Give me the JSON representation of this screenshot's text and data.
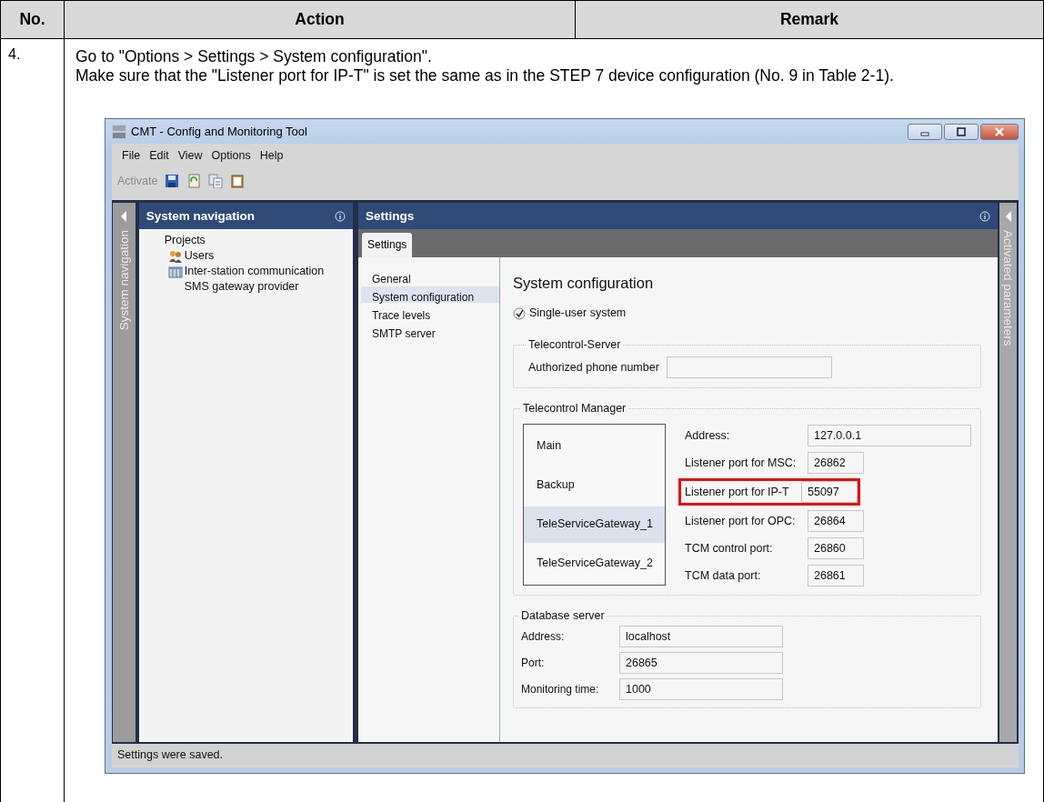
{
  "table": {
    "columns": [
      "No.",
      "Action",
      "Remark"
    ]
  },
  "step": {
    "number": "4.",
    "instructions": [
      "Go to \"Options > Settings > System configuration\".",
      "Make sure that the \"Listener port for IP-T\" is set the same as in the STEP 7 device configuration (No. 9 in Table 2-1)."
    ]
  },
  "window": {
    "title": "CMT - Config and Monitoring Tool",
    "menu": [
      "File",
      "Edit",
      "View",
      "Options",
      "Help"
    ],
    "toolbar": {
      "label": "Activate",
      "disabled": true
    },
    "left_strip": {
      "label": "System navigation"
    },
    "navigation": {
      "title": "System navigation",
      "items": [
        {
          "label": "Projects",
          "children": [
            {
              "label": "Users",
              "kind": "users"
            },
            {
              "label": "Inter-station communication",
              "kind": "table"
            },
            {
              "label": "SMS gateway provider",
              "kind": "plain"
            }
          ]
        }
      ]
    },
    "settings": {
      "title": "Settings",
      "tabs": [
        {
          "label": "Settings",
          "selected": true
        }
      ],
      "sections": [
        {
          "label": "General",
          "selected": false
        },
        {
          "label": "System configuration",
          "selected": true
        },
        {
          "label": "Trace levels",
          "selected": false
        },
        {
          "label": "SMTP server",
          "selected": false
        }
      ],
      "heading": "System configuration",
      "single_user": {
        "label": "Single-user system",
        "checked": true
      },
      "telecontrol_server": {
        "title": "Telecontrol-Server",
        "fields": [
          {
            "label": "Authorized phone number",
            "highlighted": false
          }
        ]
      },
      "telecontrol_manager": {
        "title": "Telecontrol Manager",
        "instances": [
          {
            "label": "Main",
            "selected": false
          },
          {
            "label": "Backup",
            "selected": false
          },
          {
            "label": "TeleServiceGateway_1",
            "selected": true
          },
          {
            "label": "TeleServiceGateway_2",
            "selected": false
          }
        ],
        "fields": [
          {
            "label": "Address:",
            "value": "127.0.0.1",
            "highlighted": false
          },
          {
            "label": "Listener port for MSC:",
            "value": "26862",
            "highlighted": false
          },
          {
            "label": "Listener port for IP-T",
            "value": "55097",
            "highlighted": true
          },
          {
            "label": "Listener port for OPC:",
            "value": "26864",
            "highlighted": false
          },
          {
            "label": "TCM control port:",
            "value": "26860",
            "highlighted": false
          },
          {
            "label": "TCM data port:",
            "value": "26861",
            "highlighted": false
          }
        ]
      },
      "database_server": {
        "title": "Database server",
        "fields": [
          {
            "label": "Address:",
            "value": "localhost",
            "highlighted": false
          },
          {
            "label": "Port:",
            "value": "26865",
            "highlighted": false
          },
          {
            "label": "Monitoring time:",
            "value": "1000",
            "highlighted": false
          }
        ]
      }
    },
    "right_strip": {
      "label": "Activated parameters"
    },
    "status_bar": "Settings were saved."
  }
}
